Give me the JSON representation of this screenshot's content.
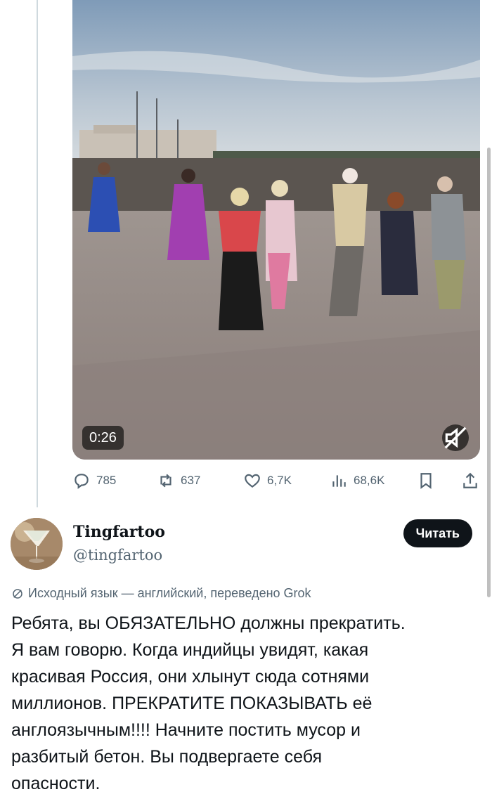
{
  "video": {
    "timestamp": "0:26",
    "muted": true
  },
  "actions": {
    "replies": "785",
    "reposts": "637",
    "likes": "6,7K",
    "views": "68,6K"
  },
  "author": {
    "name": "Tingfartoo",
    "handle": "@tingfartoo",
    "follow_label": "Читать"
  },
  "translation_note": "Исходный язык — английский, переведено Grok",
  "tweet_text": "Ребята, вы ОБЯЗАТЕЛЬНО должны прекратить.\nЯ вам говорю. Когда индийцы увидят, какая\nкрасивая Россия, они хлынут сюда сотнями\nмиллионов. ПРЕКРАТИТЕ ПОКАЗЫВАТЬ её\nанглоязычным!!!! Начните постить мусор и\nразбитый бетон. Вы подвергаете себя\nопасности.",
  "icons": [
    "reply-icon",
    "repost-icon",
    "like-icon",
    "views-icon",
    "bookmark-icon",
    "share-icon",
    "mute-icon",
    "translate-icon"
  ],
  "colors": {
    "text_primary": "#0f1419",
    "text_secondary": "#536471",
    "button_bg": "#0f1419"
  }
}
